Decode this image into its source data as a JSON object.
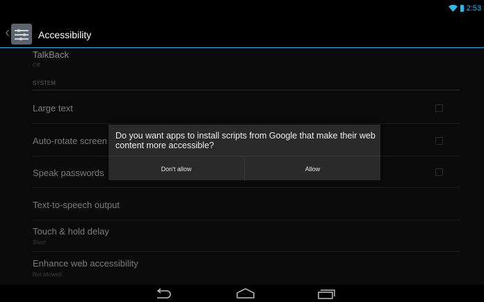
{
  "status_bar": {
    "time": "2:53"
  },
  "action_bar": {
    "title": "Accessibility"
  },
  "preferences": {
    "talkback": {
      "title": "TalkBack",
      "summary": "Off"
    },
    "section_system": "SYSTEM",
    "large_text": {
      "title": "Large text"
    },
    "auto_rotate": {
      "title": "Auto-rotate screen"
    },
    "speak_passwords": {
      "title": "Speak passwords"
    },
    "tts_output": {
      "title": "Text-to-speech output"
    },
    "touch_hold_delay": {
      "title": "Touch & hold delay",
      "summary": "Short"
    },
    "enhance_web": {
      "title": "Enhance web accessibility",
      "summary": "Not allowed"
    }
  },
  "dialog": {
    "message": "Do you want apps to install scripts from Google that make their web content more accessible?",
    "negative_button": "Don't allow",
    "positive_button": "Allow"
  },
  "colors": {
    "accent": "#33b5e5",
    "background": "#0b0b0b",
    "dialog": "#2a2a2a"
  },
  "icons": [
    "wifi-icon",
    "battery-icon",
    "settings-app-icon",
    "back-icon",
    "home-icon",
    "recent-apps-icon"
  ]
}
